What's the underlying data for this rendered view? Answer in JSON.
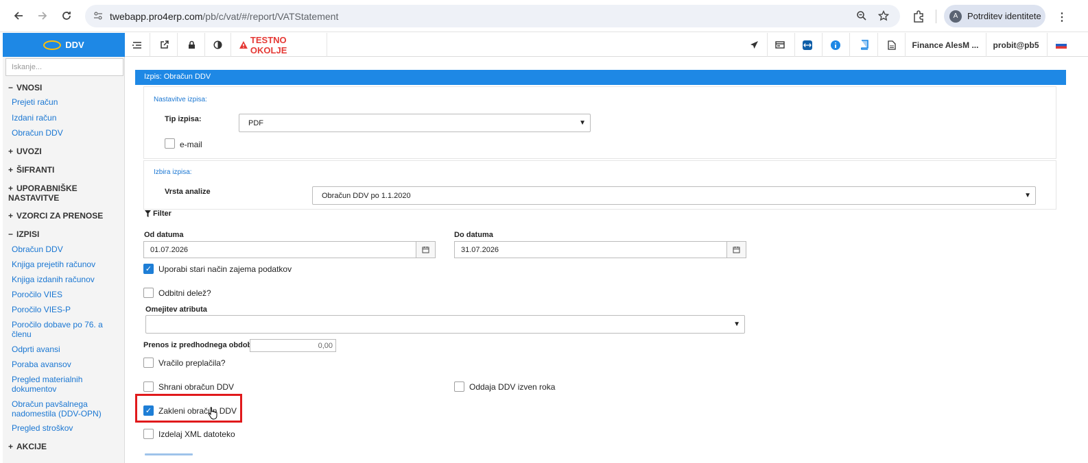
{
  "browser": {
    "url_host": "twebapp.pro4erp.com",
    "url_path": "/pb/c/vat/#/report/VATStatement",
    "identity_label": "Potrditev identitete",
    "identity_initial": "A"
  },
  "app": {
    "brand": "DDV",
    "env_label": "TESTNO OKOLJE",
    "user_company": "Finance AlesM ...",
    "user_login": "probit@pb5"
  },
  "sidebar": {
    "search_placeholder": "Iskanje...",
    "sections": [
      {
        "label": "VNOSI",
        "sign": "−"
      },
      {
        "label": "UVOZI",
        "sign": "+"
      },
      {
        "label": "ŠIFRANTI",
        "sign": "+"
      },
      {
        "label": "UPORABNIŠKE",
        "label2": "NASTAVITVE",
        "sign": "+"
      },
      {
        "label": "VZORCI ZA PRENOSE",
        "sign": "+"
      },
      {
        "label": "IZPISI",
        "sign": "−"
      },
      {
        "label": "AKCIJE",
        "sign": "+"
      }
    ],
    "vnosi_items": [
      "Prejeti račun",
      "Izdani račun",
      "Obračun DDV"
    ],
    "izpisi_items": [
      "Obračun DDV",
      "Knjiga prejetih računov",
      "Knjiga izdanih računov",
      "Poročilo VIES",
      "Poročilo VIES-P",
      "Poročilo dobave po 76. a",
      "členu",
      "Odprti avansi",
      "Poraba avansov",
      "Pregled materialnih",
      "dokumentov",
      "Obračun pavšalnega",
      "nadomestila (DDV-OPN)",
      "Pregled stroškov"
    ]
  },
  "report": {
    "title": "Izpis: Obračun DDV",
    "settings_title": "Nastavitve izpisa:",
    "tip_label": "Tip izpisa:",
    "tip_value": "PDF",
    "email_label": "e-mail",
    "choice_title": "Izbira izpisa:",
    "vrsta_label": "Vrsta analize",
    "vrsta_value": "Obračun DDV po 1.1.2020",
    "filter_label": "Filter",
    "od_label": "Od datuma",
    "od_value": "01.07.2026",
    "do_label": "Do datuma",
    "do_value": "31.07.2026",
    "old_mode_label": "Uporabi stari način zajema podatkov",
    "odbitni_label": "Odbitni delež?",
    "omejitev_label": "Omejitev atributa",
    "prenos_label": "Prenos iz predhodnega obdobja",
    "prenos_value": "0,00",
    "vracilo_label": "Vračilo preplačila?",
    "shrani_label": "Shrani obračun DDV",
    "oddaja_label": "Oddaja DDV izven roka",
    "zakleni_label": "Zakleni obračun DDV",
    "xml_label": "Izdelaj XML datoteko",
    "checked": {
      "old_mode": true,
      "zakleni": true,
      "email": false,
      "odbitni": false,
      "vracilo": false,
      "shrani": false,
      "oddaja": false,
      "xml": false
    }
  },
  "colors": {
    "accent": "#1e88e5",
    "warning": "#e53935",
    "highlight": "#e0191b"
  }
}
